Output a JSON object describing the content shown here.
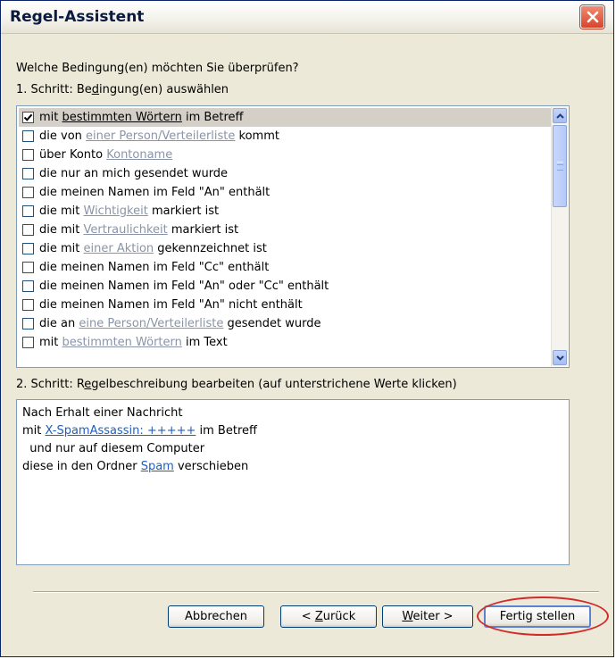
{
  "window": {
    "title": "Regel-Assistent"
  },
  "prompt": {
    "question": "Welche Bedingung(en) möchten Sie überprüfen?",
    "step1_pre": "1. Schritt: Be",
    "step1_mn": "d",
    "step1_post": "ingung(en) auswählen"
  },
  "conditions": [
    {
      "checked": true,
      "pre": "mit ",
      "link": "bestimmten Wörtern",
      "post": " im Betreff"
    },
    {
      "checked": false,
      "pre": "die von ",
      "link": "einer Person/Verteilerliste",
      "post": " kommt"
    },
    {
      "checked": false,
      "pre": "über Konto ",
      "link": "Kontoname",
      "post": ""
    },
    {
      "checked": false,
      "pre": "die nur an mich gesendet wurde",
      "link": "",
      "post": ""
    },
    {
      "checked": false,
      "pre": "die meinen Namen im Feld \"An\" enthält",
      "link": "",
      "post": ""
    },
    {
      "checked": false,
      "pre": "die mit ",
      "link": "Wichtigkeit",
      "post": " markiert ist"
    },
    {
      "checked": false,
      "pre": "die mit ",
      "link": "Vertraulichkeit",
      "post": " markiert ist"
    },
    {
      "checked": false,
      "pre": "die mit ",
      "link": "einer Aktion",
      "post": " gekennzeichnet ist"
    },
    {
      "checked": false,
      "pre": "die meinen Namen im Feld \"Cc\" enthält",
      "link": "",
      "post": ""
    },
    {
      "checked": false,
      "pre": "die meinen Namen im Feld \"An\" oder \"Cc\" enthält",
      "link": "",
      "post": ""
    },
    {
      "checked": false,
      "pre": "die meinen Namen im Feld \"An\" nicht enthält",
      "link": "",
      "post": ""
    },
    {
      "checked": false,
      "pre": "die an ",
      "link": "eine Person/Verteilerliste",
      "post": " gesendet wurde"
    },
    {
      "checked": false,
      "pre": "mit ",
      "link": "bestimmten Wörtern",
      "post": " im Text"
    }
  ],
  "step2": {
    "pre": "2. Schritt: R",
    "mn": "e",
    "post": "gelbeschreibung bearbeiten (auf unterstrichene Werte klicken)"
  },
  "description": [
    {
      "pre": "Nach Erhalt einer Nachricht",
      "link": "",
      "post": ""
    },
    {
      "pre": "mit ",
      "link": "X-SpamAssassin: +++++",
      "post": " im Betreff"
    },
    {
      "pre": "  und nur auf diesem Computer",
      "link": "",
      "post": ""
    },
    {
      "pre": "diese in den Ordner ",
      "link": "Spam",
      "post": " verschieben"
    }
  ],
  "buttons": {
    "cancel": "Abbrechen",
    "back_pre": "< ",
    "back_mn": "Z",
    "back_post": "urück",
    "next_mn": "W",
    "next_post": "eiter >",
    "finish": "Fertig stellen"
  },
  "colors": {
    "annotation": "#d22a2a",
    "selection": "#d4d0c8",
    "link_inactive": "#8a94a8",
    "link_active": "#1f5fbf"
  }
}
